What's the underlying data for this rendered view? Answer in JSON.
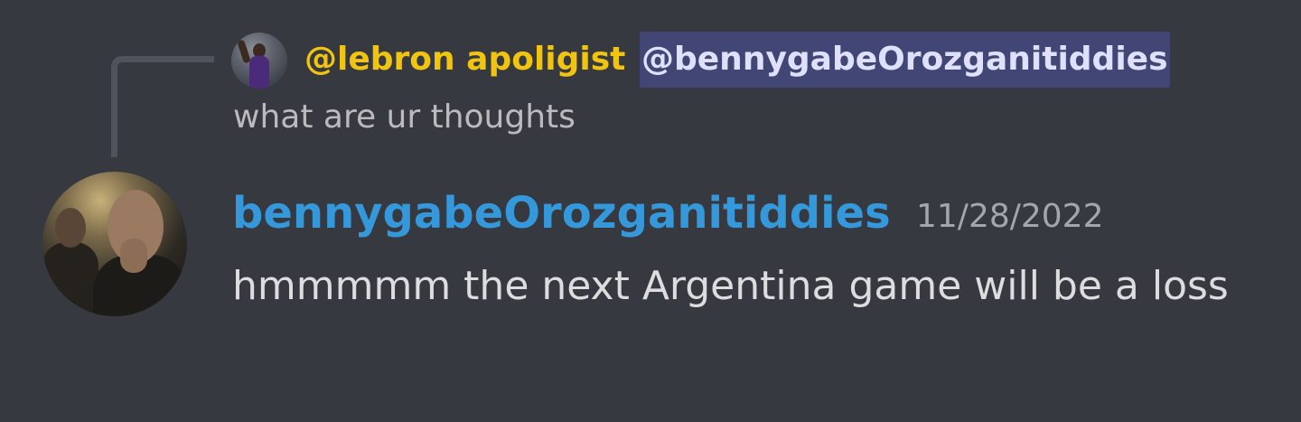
{
  "reply": {
    "author": "@lebron apoligist",
    "mention": "@bennygabeOrozganitiddies",
    "text": "what are ur thoughts"
  },
  "message": {
    "username": "bennygabeOrozganitiddies",
    "timestamp": "11/28/2022",
    "content": "hmmmmm the next Argentina game will be a loss"
  },
  "colors": {
    "background": "#36393f",
    "reply_author": "#f1c40f",
    "mention_bg": "#414675",
    "mention_text": "#dee0fc",
    "username": "#3498db",
    "timestamp": "#a3a6aa",
    "message_text": "#dcddde"
  }
}
